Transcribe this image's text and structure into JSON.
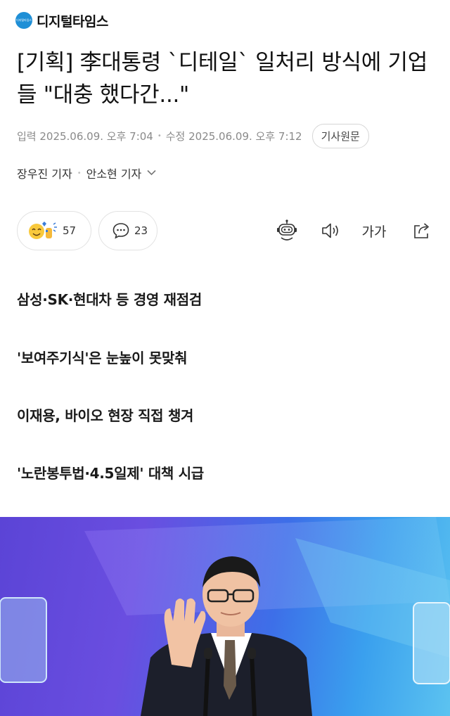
{
  "masthead": {
    "logo_badge": "디지털타임스",
    "name": "디지털타임스"
  },
  "article": {
    "title": "[기획] 李대통령 `디테일` 일처리 방식에 기업들 \"대충 했다간...\"",
    "published": "입력 2025.06.09. 오후 7:04",
    "updated": "수정 2025.06.09. 오후 7:12",
    "original_button": "기사원문",
    "reporters": [
      "장우진 기자",
      "안소현 기자"
    ],
    "reaction_count": "57",
    "comment_count": "23",
    "font_size_label": "가가",
    "summary": [
      "삼성·SK·현대차 등 경영 재점검",
      "'보여주기식'은 눈높이 못맞춰",
      "이재용, 바이오 현장 직접 챙겨",
      "'노란봉투법·4.5일제' 대책 시급"
    ]
  },
  "colors": {
    "accent_blue": "#1f8fd6",
    "meta_gray": "#8a8a8a",
    "photo_purple": "#5b44d6",
    "photo_blue": "#3aa0ee"
  }
}
